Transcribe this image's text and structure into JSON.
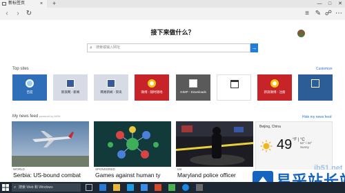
{
  "window": {
    "tab_title": "新标签页",
    "new_tab_symbol": "+",
    "close_symbol": "×"
  },
  "search": {
    "heading": "接下来做什么？",
    "placeholder": "搜索或输入网址",
    "go_symbol": "→"
  },
  "top_sites": {
    "label": "Top sites",
    "customize": "Customize",
    "tiles": [
      {
        "label": "百度",
        "color": "#2f6eb8",
        "icon": "globe-icon"
      },
      {
        "label": "新浪网 - 新闻",
        "color": "#d6dbe6",
        "icon": "web-page-icon"
      },
      {
        "label": "网易新闻 - 资讯",
        "color": "#d6dbe6",
        "icon": "web-page-icon"
      },
      {
        "label": "微博 - 随时随地",
        "color": "#c7242a",
        "icon": "weibo-icon"
      },
      {
        "label": "GIMP - Downloads",
        "color": "#5a5a5a",
        "icon": "gimp-icon"
      },
      {
        "label": "",
        "color": "#ffffff",
        "icon": "browser-window-icon"
      },
      {
        "label": "新浪微博 - 注册",
        "color": "#c7242a",
        "icon": "weibo-icon"
      },
      {
        "label": "",
        "color": "#2c5d96",
        "icon": "video-icon"
      }
    ]
  },
  "news": {
    "label": "My news feed",
    "powered_by": "powered by MSN",
    "hide_link": "Hide my news feed",
    "cards": [
      {
        "source": "WORLD",
        "title": "Serbia: US-bound combat",
        "image": "airplane-photo"
      },
      {
        "source": "SPONSORED",
        "title": "Games against human ty",
        "image": "molecules-photo"
      },
      {
        "source": "US",
        "title": "Maryland police officer",
        "image": "police-scene-photo"
      }
    ]
  },
  "weather": {
    "location": "Beijing, China",
    "temp": "49",
    "units": "°F | °C",
    "high_low": "52° / 34°\nSunny"
  },
  "taskbar": {
    "search_placeholder": "搜索 Web 和 Windows"
  },
  "watermark": {
    "url": "ib51.net",
    "text": "易采站长站"
  },
  "colors": {
    "accent": "#1f7ed8",
    "taskbar": "#1d2733"
  }
}
